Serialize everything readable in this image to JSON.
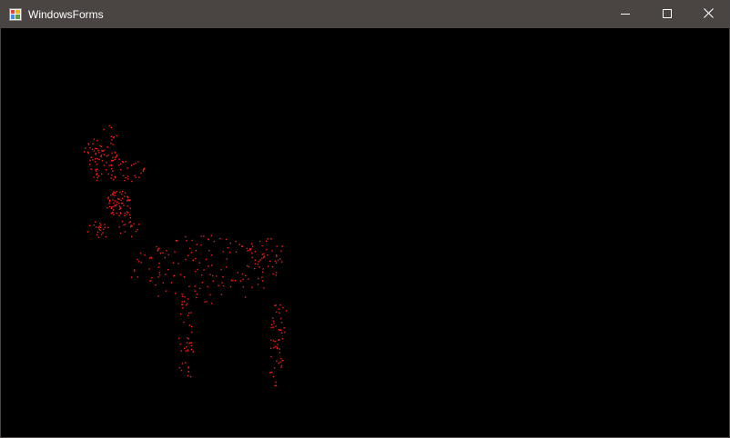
{
  "window": {
    "title": "WindowsForms",
    "app_icon": "windows-forms-app-icon",
    "buttons": {
      "minimize": "minimize-icon",
      "maximize": "maximize-icon",
      "close": "close-icon"
    }
  },
  "canvas": {
    "background": "#000000",
    "particle_color": "#ff1a1a",
    "subject": "reindeer-particle-figure"
  }
}
